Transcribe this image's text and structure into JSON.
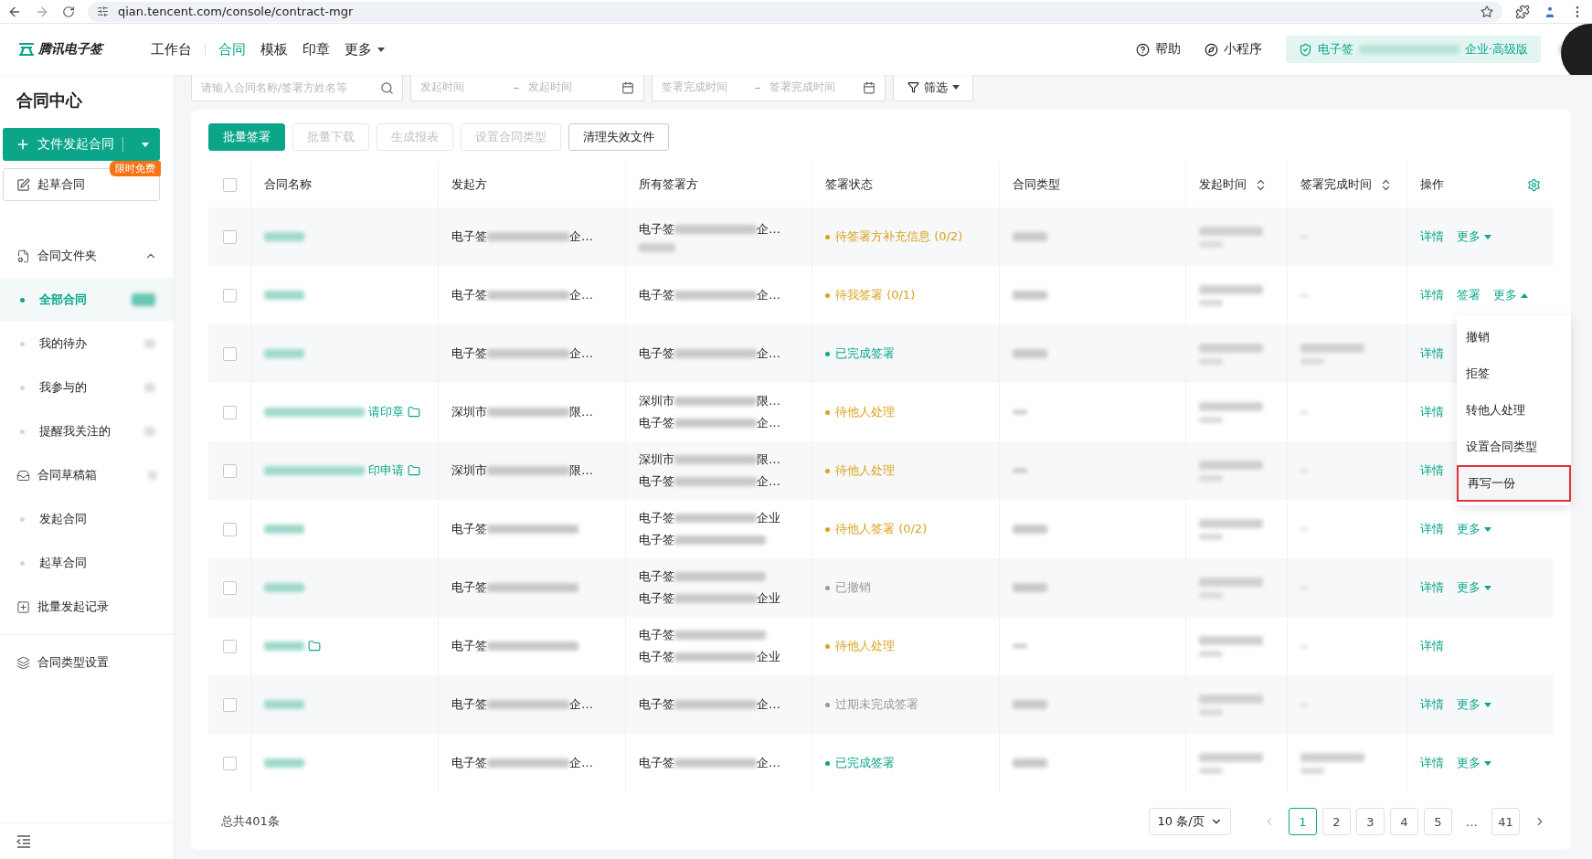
{
  "browser": {
    "url": "qian.tencent.com/console/contract-mgr"
  },
  "header": {
    "logo": "腾讯电子签",
    "nav": [
      {
        "label": "工作台",
        "selected": false,
        "kind": "link"
      },
      {
        "label": "合同",
        "selected": true,
        "kind": "link"
      },
      {
        "label": "模板",
        "selected": false,
        "kind": "link"
      },
      {
        "label": "印章",
        "selected": false,
        "kind": "link"
      },
      {
        "label": "更多",
        "selected": false,
        "kind": "dropdown"
      }
    ],
    "help": "帮助",
    "miniapp": "小程序",
    "org": {
      "prefix": "电子签",
      "suffix": "企业·高级版"
    }
  },
  "filters": {
    "search_placeholder": "请输入合同名称/签署方姓名等",
    "ranges": [
      {
        "start": "发起时间",
        "separator": "–",
        "end": "发起时间"
      },
      {
        "start": "签署完成时间",
        "separator": "–",
        "end": "签署完成时间"
      }
    ],
    "filter_button": "筛选"
  },
  "sidebar": {
    "title": "合同中心",
    "primary": "文件发起合同",
    "draft": {
      "label": "起草合同",
      "badge": "限时免费"
    },
    "groups": [
      {
        "label": "合同文件夹",
        "expanded": true,
        "children": [
          {
            "label": "全部合同",
            "selected": true,
            "has_count": true
          },
          {
            "label": "我的待办",
            "selected": false,
            "has_count": true
          },
          {
            "label": "我参与的",
            "selected": false,
            "has_count": true
          },
          {
            "label": "提醒我关注的",
            "selected": false,
            "has_count": true
          }
        ]
      },
      {
        "label": "合同草稿箱",
        "has_count": true,
        "children": [
          {
            "label": "发起合同",
            "selected": false
          },
          {
            "label": "起草合同",
            "selected": false
          }
        ]
      },
      {
        "label": "批量发起记录"
      },
      {
        "label": "合同类型设置",
        "divider_before": true
      }
    ]
  },
  "toolbar": [
    {
      "label": "批量签署",
      "kind": "primary",
      "disabled": false
    },
    {
      "label": "批量下载",
      "kind": "default",
      "disabled": true
    },
    {
      "label": "生成报表",
      "kind": "default",
      "disabled": true
    },
    {
      "label": "设置合同类型",
      "kind": "default",
      "disabled": true
    },
    {
      "label": "清理失效文件",
      "kind": "default",
      "disabled": false
    }
  ],
  "table": {
    "all_checked": false,
    "columns": [
      {
        "label": "合同名称",
        "sortable": false
      },
      {
        "label": "发起方",
        "sortable": false
      },
      {
        "label": "所有签署方",
        "sortable": false
      },
      {
        "label": "签署状态",
        "sortable": false
      },
      {
        "label": "合同类型",
        "sortable": false
      },
      {
        "label": "发起时间",
        "sortable": true
      },
      {
        "label": "签署完成时间",
        "sortable": true
      },
      {
        "label": "操作",
        "sortable": false
      }
    ],
    "rows": [
      {
        "checked": false,
        "name": {
          "folder": false
        },
        "initiator": {
          "prefix": "电子签",
          "suffix": "企…"
        },
        "signers": [
          {
            "kind": "text",
            "prefix": "电子签",
            "suffix": "企…"
          },
          {
            "kind": "redacted"
          }
        ],
        "status": {
          "label": "待签署方补充信息 (0/2)",
          "color": "#d9a21b"
        },
        "type_blank": false,
        "finished": false,
        "actions": [
          {
            "label": "详情",
            "kind": "link"
          },
          {
            "label": "更多",
            "kind": "more",
            "expanded": false
          }
        ]
      },
      {
        "checked": false,
        "name": {
          "folder": false
        },
        "initiator": {
          "prefix": "电子签",
          "suffix": "企…"
        },
        "signers": [
          {
            "kind": "text",
            "prefix": "电子签",
            "suffix": "企…"
          }
        ],
        "status": {
          "label": "待我签署 (0/1)",
          "color": "#d9a21b"
        },
        "type_blank": false,
        "finished": false,
        "actions": [
          {
            "label": "详情",
            "kind": "link"
          },
          {
            "label": "签署",
            "kind": "link"
          },
          {
            "label": "更多",
            "kind": "more",
            "expanded": true
          }
        ]
      },
      {
        "checked": false,
        "name": {
          "folder": false
        },
        "initiator": {
          "prefix": "电子签",
          "suffix": "企…"
        },
        "signers": [
          {
            "kind": "text",
            "prefix": "电子签",
            "suffix": "企…"
          }
        ],
        "status": {
          "label": "已完成签署",
          "color": "#0ba68a"
        },
        "type_blank": false,
        "finished": true,
        "actions": [
          {
            "label": "详情",
            "kind": "link"
          }
        ]
      },
      {
        "checked": false,
        "name": {
          "visible": "请印章",
          "folder": true
        },
        "initiator": {
          "prefix": "深圳市",
          "suffix": "限…"
        },
        "signers": [
          {
            "kind": "text",
            "prefix": "深圳市",
            "suffix": "限…"
          },
          {
            "kind": "text",
            "prefix": "电子签",
            "suffix": "企…"
          }
        ],
        "status": {
          "label": "待他人处理",
          "color": "#d9a21b"
        },
        "type_blank": true,
        "finished": false,
        "actions": [
          {
            "label": "详情",
            "kind": "link"
          }
        ]
      },
      {
        "checked": false,
        "name": {
          "visible": "印申请",
          "folder": true
        },
        "initiator": {
          "prefix": "深圳市",
          "suffix": "限…"
        },
        "signers": [
          {
            "kind": "text",
            "prefix": "深圳市",
            "suffix": "限…"
          },
          {
            "kind": "text",
            "prefix": "电子签",
            "suffix": "企…"
          }
        ],
        "status": {
          "label": "待他人处理",
          "color": "#d9a21b"
        },
        "type_blank": true,
        "finished": false,
        "actions": [
          {
            "label": "详情",
            "kind": "link"
          }
        ]
      },
      {
        "checked": false,
        "name": {
          "folder": false
        },
        "initiator": {
          "prefix": "电子签"
        },
        "signers": [
          {
            "kind": "text",
            "prefix": "电子签",
            "suffix": "企业"
          },
          {
            "kind": "text",
            "prefix": "电子签"
          }
        ],
        "status": {
          "label": "待他人签署 (0/2)",
          "color": "#d9a21b"
        },
        "type_blank": false,
        "finished": false,
        "actions": [
          {
            "label": "详情",
            "kind": "link"
          },
          {
            "label": "更多",
            "kind": "more",
            "expanded": false
          }
        ]
      },
      {
        "checked": false,
        "name": {
          "folder": false
        },
        "initiator": {
          "prefix": "电子签"
        },
        "signers": [
          {
            "kind": "text",
            "prefix": "电子签"
          },
          {
            "kind": "text",
            "prefix": "电子签",
            "suffix": "企业"
          }
        ],
        "status": {
          "label": "已撤销",
          "color": "#999999"
        },
        "type_blank": false,
        "finished": false,
        "actions": [
          {
            "label": "详情",
            "kind": "link"
          },
          {
            "label": "更多",
            "kind": "more",
            "expanded": false
          }
        ]
      },
      {
        "checked": false,
        "name": {
          "folder": true
        },
        "initiator": {
          "prefix": "电子签"
        },
        "signers": [
          {
            "kind": "text",
            "prefix": "电子签"
          },
          {
            "kind": "text",
            "prefix": "电子签",
            "suffix": "企业"
          }
        ],
        "status": {
          "label": "待他人处理",
          "color": "#d9a21b"
        },
        "type_blank": true,
        "finished": false,
        "actions": [
          {
            "label": "详情",
            "kind": "link"
          }
        ]
      },
      {
        "checked": false,
        "name": {
          "folder": false
        },
        "initiator": {
          "prefix": "电子签",
          "suffix": "企…"
        },
        "signers": [
          {
            "kind": "text",
            "prefix": "电子签",
            "suffix": "企…"
          }
        ],
        "status": {
          "label": "过期未完成签署",
          "color": "#999999"
        },
        "type_blank": false,
        "finished": false,
        "actions": [
          {
            "label": "详情",
            "kind": "link"
          },
          {
            "label": "更多",
            "kind": "more",
            "expanded": false
          }
        ]
      },
      {
        "checked": false,
        "name": {
          "folder": false
        },
        "initiator": {
          "prefix": "电子签",
          "suffix": "企…"
        },
        "signers": [
          {
            "kind": "text",
            "prefix": "电子签",
            "suffix": "企…"
          }
        ],
        "status": {
          "label": "已完成签署",
          "color": "#0ba68a"
        },
        "type_blank": false,
        "finished": true,
        "actions": [
          {
            "label": "详情",
            "kind": "link"
          },
          {
            "label": "更多",
            "kind": "more",
            "expanded": false
          }
        ]
      }
    ]
  },
  "menu": {
    "items": [
      {
        "label": "撤销",
        "highlighted": false
      },
      {
        "label": "拒签",
        "highlighted": false
      },
      {
        "label": "转他人处理",
        "highlighted": false
      },
      {
        "label": "设置合同类型",
        "highlighted": false
      },
      {
        "label": "再写一份",
        "highlighted": true
      }
    ]
  },
  "pagination": {
    "total": "总共401条",
    "page_size": "10 条/页",
    "pages": [
      {
        "label": "1",
        "selected": true
      },
      {
        "label": "2",
        "selected": false
      },
      {
        "label": "3",
        "selected": false
      },
      {
        "label": "4",
        "selected": false
      },
      {
        "label": "5",
        "selected": false
      },
      {
        "label": "…",
        "selected": false
      },
      {
        "label": "41",
        "selected": false
      }
    ]
  }
}
